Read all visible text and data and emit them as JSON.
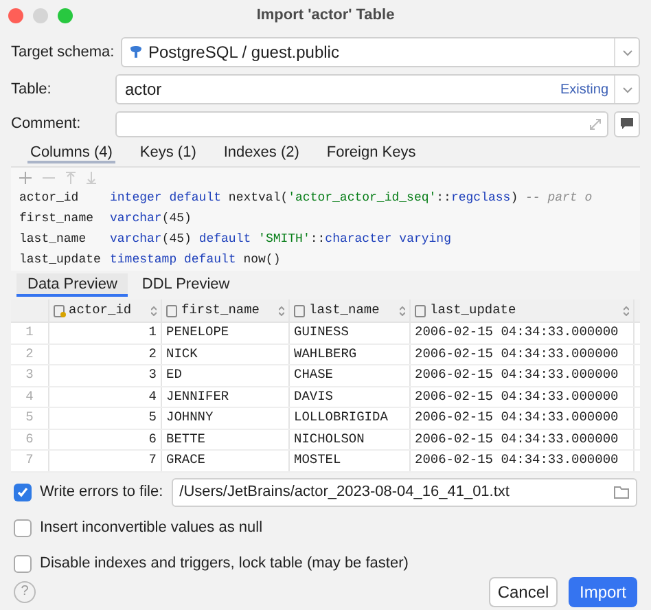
{
  "window": {
    "title": "Import 'actor' Table"
  },
  "form": {
    "target_schema": {
      "label": "Target schema:",
      "value": "PostgreSQL / guest.public"
    },
    "table": {
      "label": "Table:",
      "value": "actor",
      "badge": "Existing"
    },
    "comment": {
      "label": "Comment:"
    }
  },
  "tabs": [
    {
      "label": "Columns (4)",
      "selected": true
    },
    {
      "label": "Keys (1)",
      "selected": false
    },
    {
      "label": "Indexes (2)",
      "selected": false
    },
    {
      "label": "Foreign Keys",
      "selected": false
    }
  ],
  "columns_code": [
    {
      "name": "actor_id",
      "tokens": [
        {
          "kind": "keyword",
          "text": "integer default"
        },
        {
          "kind": "plain",
          "text": " nextval("
        },
        {
          "kind": "string",
          "text": "'actor_actor_id_seq'"
        },
        {
          "kind": "plain",
          "text": "::"
        },
        {
          "kind": "keyword",
          "text": "regclass"
        },
        {
          "kind": "plain",
          "text": ") "
        },
        {
          "kind": "comment",
          "text": "-- part o"
        }
      ]
    },
    {
      "name": "first_name",
      "tokens": [
        {
          "kind": "keyword",
          "text": "varchar"
        },
        {
          "kind": "plain",
          "text": "(45)"
        }
      ]
    },
    {
      "name": "last_name",
      "tokens": [
        {
          "kind": "keyword",
          "text": "varchar"
        },
        {
          "kind": "plain",
          "text": "(45) "
        },
        {
          "kind": "keyword",
          "text": "default "
        },
        {
          "kind": "string",
          "text": "'SMITH'"
        },
        {
          "kind": "plain",
          "text": "::"
        },
        {
          "kind": "keyword",
          "text": "character varying"
        }
      ]
    },
    {
      "name": "last_update",
      "tokens": [
        {
          "kind": "keyword",
          "text": "timestamp default"
        },
        {
          "kind": "plain",
          "text": " now()"
        }
      ]
    }
  ],
  "preview_tabs": [
    {
      "label": "Data Preview",
      "selected": true
    },
    {
      "label": "DDL Preview",
      "selected": false
    }
  ],
  "table": {
    "columns": [
      {
        "label": "actor_id",
        "key": true
      },
      {
        "label": "first_name",
        "key": false
      },
      {
        "label": "last_name",
        "key": false
      },
      {
        "label": "last_update",
        "key": false
      }
    ],
    "rows": [
      {
        "num": "1",
        "cells": [
          "1",
          "PENELOPE",
          "GUINESS",
          "2006-02-15 04:34:33.000000"
        ]
      },
      {
        "num": "2",
        "cells": [
          "2",
          "NICK",
          "WAHLBERG",
          "2006-02-15 04:34:33.000000"
        ]
      },
      {
        "num": "3",
        "cells": [
          "3",
          "ED",
          "CHASE",
          "2006-02-15 04:34:33.000000"
        ]
      },
      {
        "num": "4",
        "cells": [
          "4",
          "JENNIFER",
          "DAVIS",
          "2006-02-15 04:34:33.000000"
        ]
      },
      {
        "num": "5",
        "cells": [
          "5",
          "JOHNNY",
          "LOLLOBRIGIDA",
          "2006-02-15 04:34:33.000000"
        ]
      },
      {
        "num": "6",
        "cells": [
          "6",
          "BETTE",
          "NICHOLSON",
          "2006-02-15 04:34:33.000000"
        ]
      },
      {
        "num": "7",
        "cells": [
          "7",
          "GRACE",
          "MOSTEL",
          "2006-02-15 04:34:33.000000"
        ]
      }
    ]
  },
  "options": [
    {
      "label": "Write errors to file:",
      "checked": true,
      "path": "/Users/JetBrains/actor_2023-08-04_16_41_01.txt"
    },
    {
      "label": "Insert inconvertible values as null",
      "checked": false
    },
    {
      "label": "Disable indexes and triggers, lock table (may be faster)",
      "checked": false
    }
  ],
  "help": "?",
  "buttons": [
    {
      "label": "Cancel",
      "primary": false
    },
    {
      "label": "Import",
      "primary": true
    }
  ]
}
